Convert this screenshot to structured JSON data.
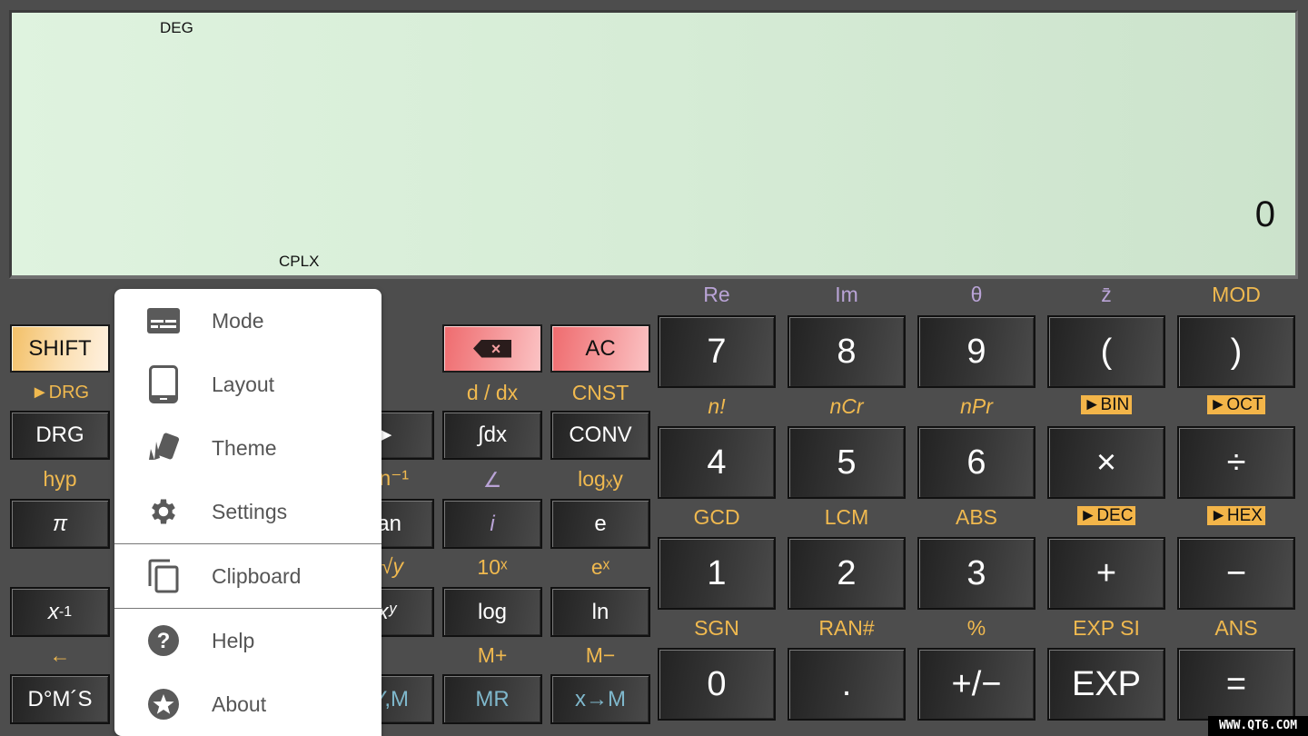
{
  "display": {
    "angle_mode": "DEG",
    "complex_mode": "CPLX",
    "result": "0"
  },
  "left_keys": {
    "shift": "SHIFT",
    "drg_label": "►DRG",
    "drg": "DRG",
    "hyp_label": "hyp",
    "pi": "π",
    "inverse": "x",
    "inverse_sup": "-1",
    "dms_label": "←",
    "dms": "D°M´S"
  },
  "partial_col": {
    "arrow": "►",
    "tan_inv_label": "n⁻¹",
    "tan": "an",
    "root_label": "√y",
    "power": "xʸ",
    "mem_key": "Y,M"
  },
  "mid_keys": {
    "backspace_icon": "×",
    "ac": "AC",
    "ddx_label": "d / dx",
    "cnst_label": "CNST",
    "integral": "∫dx",
    "conv": "CONV",
    "angle_label": "∠",
    "logxy_label": "logₓy",
    "i": "i",
    "e": "e",
    "tenx_label": "10ˣ",
    "ex_label": "eˣ",
    "log": "log",
    "ln": "ln",
    "mplus_label": "M+",
    "mminus_label": "M−",
    "mr": "MR",
    "xtom": "x→M"
  },
  "numpad": {
    "rows": [
      {
        "labels": [
          {
            "text": "Re",
            "style": "purple"
          },
          {
            "text": "Im",
            "style": "purple"
          },
          {
            "text": "θ",
            "style": "purple"
          },
          {
            "text": "z̄",
            "style": "purple"
          },
          {
            "text": "MOD",
            "style": "orange"
          }
        ],
        "keys": [
          "7",
          "8",
          "9",
          "(",
          ")"
        ]
      },
      {
        "labels": [
          {
            "text": "n!",
            "style": "orange-italic"
          },
          {
            "text": "nCr",
            "style": "orange-italic"
          },
          {
            "text": "nPr",
            "style": "orange-italic"
          },
          {
            "text": "►BIN",
            "style": "tag"
          },
          {
            "text": "►OCT",
            "style": "tag"
          }
        ],
        "keys": [
          "4",
          "5",
          "6",
          "×",
          "÷"
        ]
      },
      {
        "labels": [
          {
            "text": "GCD",
            "style": "orange"
          },
          {
            "text": "LCM",
            "style": "orange"
          },
          {
            "text": "ABS",
            "style": "orange"
          },
          {
            "text": "►DEC",
            "style": "tag"
          },
          {
            "text": "►HEX",
            "style": "tag"
          }
        ],
        "keys": [
          "1",
          "2",
          "3",
          "+",
          "−"
        ]
      },
      {
        "labels": [
          {
            "text": "SGN",
            "style": "orange"
          },
          {
            "text": "RAN#",
            "style": "orange"
          },
          {
            "text": "%",
            "style": "orange"
          },
          {
            "text": "EXP SI",
            "style": "orange"
          },
          {
            "text": "ANS",
            "style": "orange"
          }
        ],
        "keys": [
          "0",
          ".",
          "+/−",
          "EXP",
          "="
        ]
      }
    ]
  },
  "menu": {
    "items": [
      {
        "label": "Mode",
        "icon": "mode-icon"
      },
      {
        "label": "Layout",
        "icon": "tablet-icon"
      },
      {
        "label": "Theme",
        "icon": "theme-icon"
      },
      {
        "label": "Settings",
        "icon": "gear-icon"
      },
      {
        "label": "Clipboard",
        "icon": "copy-icon"
      },
      {
        "label": "Help",
        "icon": "help-icon"
      },
      {
        "label": "About",
        "icon": "star-icon"
      }
    ]
  },
  "colors": {
    "shift_label": "#f0b94f",
    "complex_label": "#b9a3d6",
    "memory_key": "#7fb8cc",
    "display_bg": "#d6ecd6",
    "body_bg": "#4d4d4d"
  },
  "watermark": "WWW.QT6.COM"
}
